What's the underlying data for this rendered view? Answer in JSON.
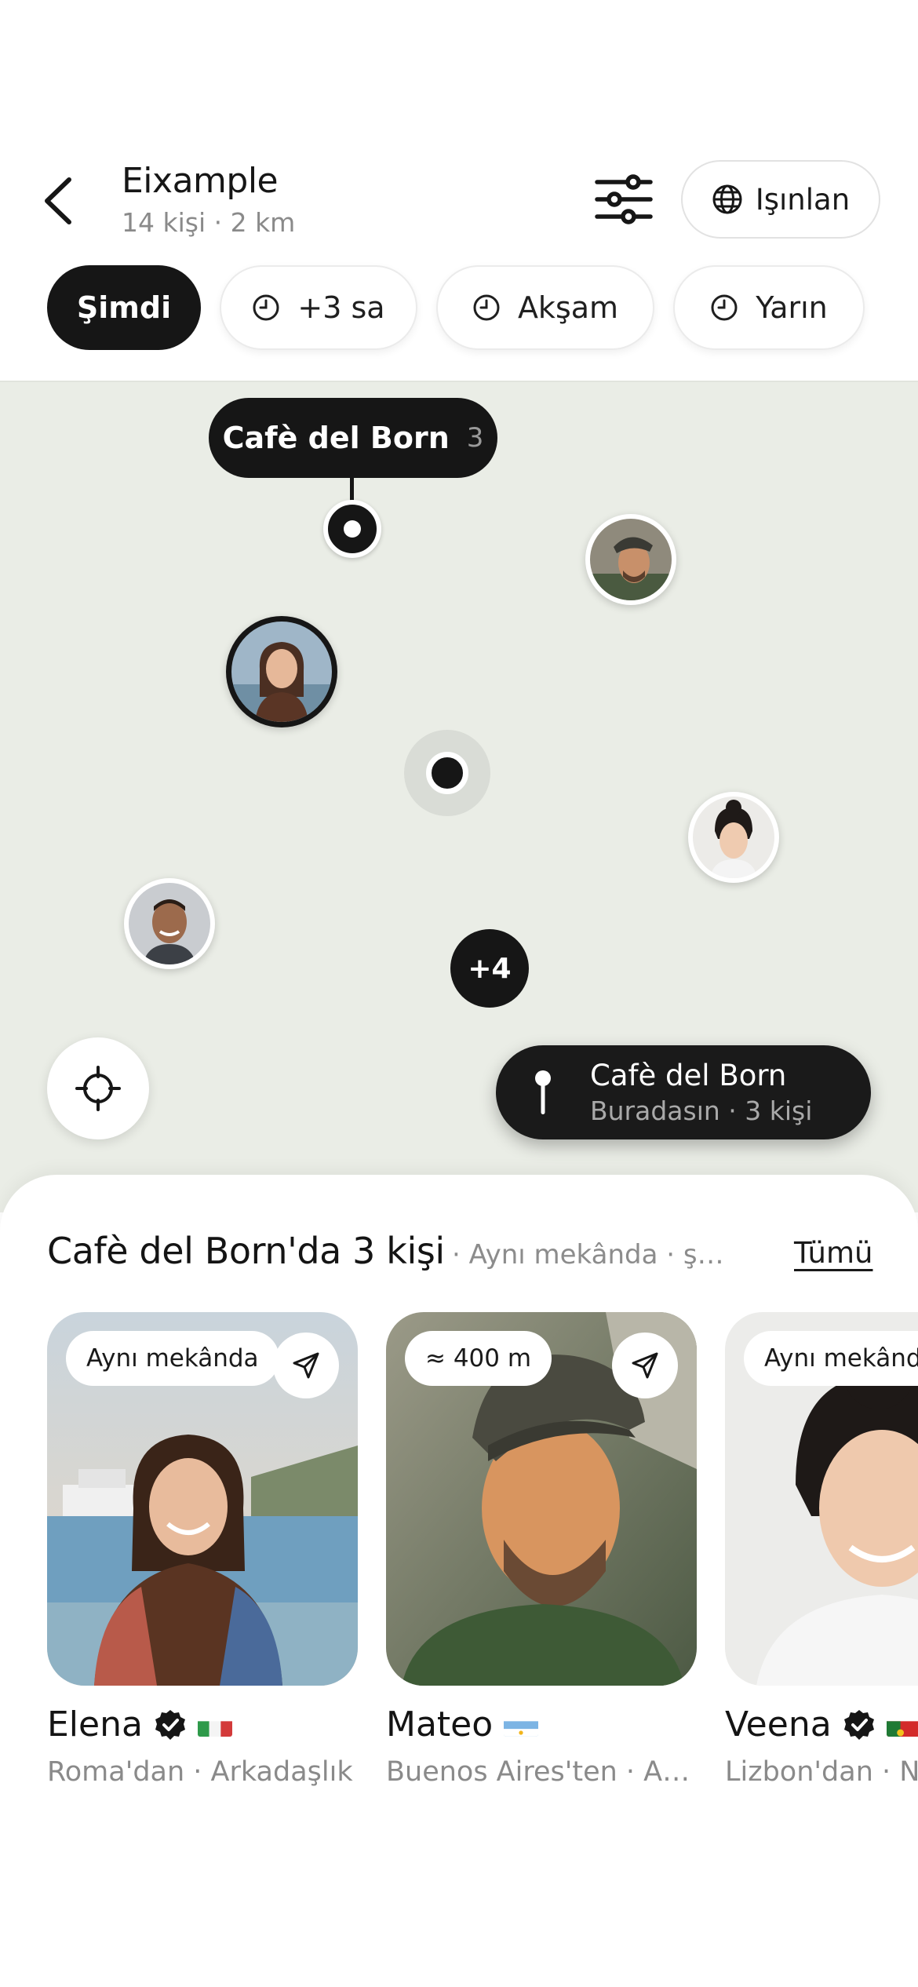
{
  "header": {
    "title": "Eixample",
    "subtitle": "14 kişi · 2 km",
    "teleport_label": "Işınlan"
  },
  "time_chips": [
    {
      "label": "Şimdi",
      "active": true
    },
    {
      "label": "+3 sa",
      "active": false
    },
    {
      "label": "Akşam",
      "active": false
    },
    {
      "label": "Yarın",
      "active": false
    }
  ],
  "map": {
    "venue_label": "Cafè del Born",
    "venue_count": "3",
    "cluster_label": "+4",
    "here_card": {
      "title": "Cafè del Born",
      "subtitle": "Buradasın · 3 kişi"
    }
  },
  "sheet": {
    "title": "Cafè del Born'da 3 kişi",
    "subtitle": "· Aynı mekânda · şu an",
    "see_all": "Tümü",
    "cards": [
      {
        "badge": "Aynı mekânda",
        "name": "Elena",
        "verified": true,
        "flag": "italy",
        "meta": "Roma'dan · Arkadaşlık"
      },
      {
        "badge": "≈ 400 m",
        "name": "Mateo",
        "verified": false,
        "flag": "argentina",
        "meta": "Buenos Aires'ten · Arkadaşlık"
      },
      {
        "badge": "Aynı mekânda",
        "name": "Veena",
        "verified": true,
        "flag": "portugal",
        "meta": "Lizbon'dan · Networking"
      }
    ]
  },
  "colors": {
    "ink": "#161616",
    "map_bg": "#eaede6",
    "muted_text": "#8a8a8a"
  }
}
